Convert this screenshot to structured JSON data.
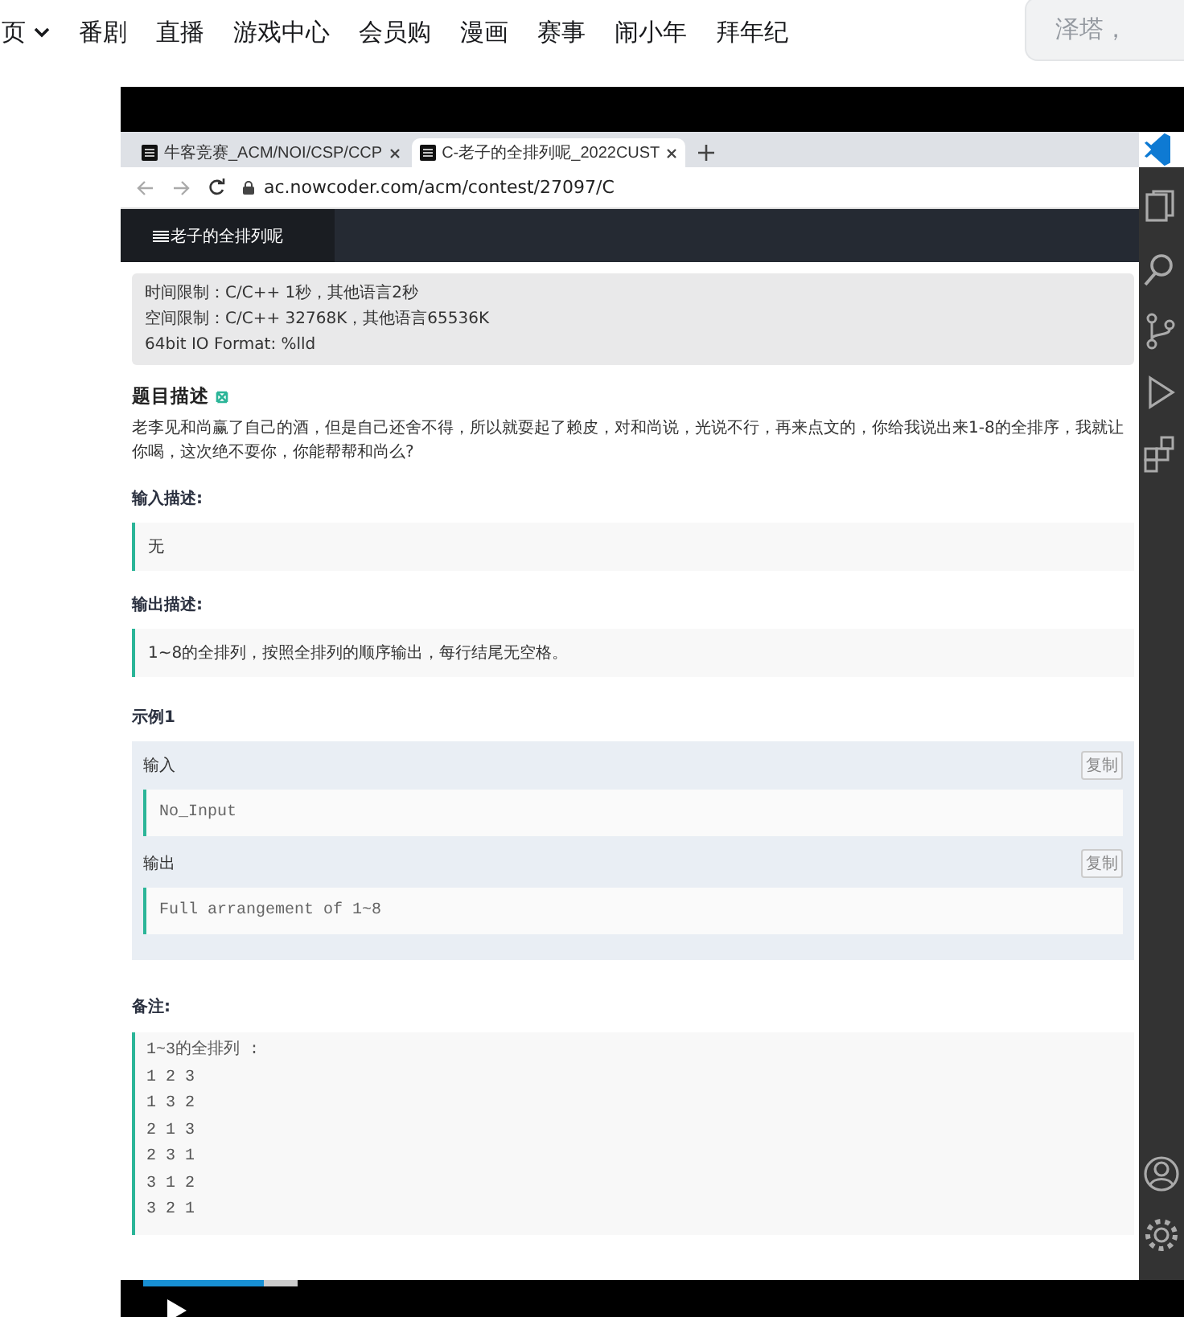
{
  "top_nav": {
    "items": [
      {
        "label": "页",
        "dropdown": true
      },
      {
        "label": "番剧",
        "dropdown": false
      },
      {
        "label": "直播",
        "dropdown": false
      },
      {
        "label": "游戏中心",
        "dropdown": false
      },
      {
        "label": "会员购",
        "dropdown": false
      },
      {
        "label": "漫画",
        "dropdown": false
      },
      {
        "label": "赛事",
        "dropdown": false
      },
      {
        "label": "闹小年",
        "dropdown": false
      },
      {
        "label": "拜年纪",
        "dropdown": false
      }
    ],
    "search": {
      "placeholder": "泽塔，"
    }
  },
  "video": {
    "browser": {
      "tabs": [
        {
          "title": "牛客竞赛_ACM/NOI/CSP/CCP",
          "selected": false
        },
        {
          "title": "C-老子的全排列呢_2022CUST",
          "selected": true
        }
      ],
      "url": "ac.nowcoder.com/acm/contest/27097/C",
      "page_title": "老子的全排列呢",
      "limits": [
        "时间限制：C/C++ 1秒，其他语言2秒",
        "空间限制：C/C++ 32768K，其他语言65536K",
        "64bit IO Format: %lld"
      ],
      "description_heading": "题目描述",
      "description": "老李见和尚赢了自己的酒，但是自己还舍不得，所以就耍起了赖皮，对和尚说，光说不行，再来点文的，你给我说出来1-8的全排序，我就让你喝，这次绝不耍你，你能帮帮和尚么?",
      "sections": [
        {
          "heading": "输入描述:",
          "body": "无"
        },
        {
          "heading": "输出描述:",
          "body": "1~8的全排列，按照全排列的顺序输出，每行结尾无空格。"
        }
      ],
      "example": {
        "title": "示例1",
        "blocks": [
          {
            "label": "输入",
            "copy": "复制",
            "code": "No_Input"
          },
          {
            "label": "输出",
            "copy": "复制",
            "code": "Full arrangement of 1~8"
          }
        ]
      },
      "note": {
        "heading": "备注:",
        "lines": [
          "1~3的全排列  :",
          "1 2 3",
          "1 3 2",
          "2 1 3",
          "2 3 1",
          "3 1 2",
          "3 2 1"
        ]
      }
    },
    "progress": {
      "level": 0.125,
      "buffered": {
        "level": 0.16
      }
    }
  }
}
